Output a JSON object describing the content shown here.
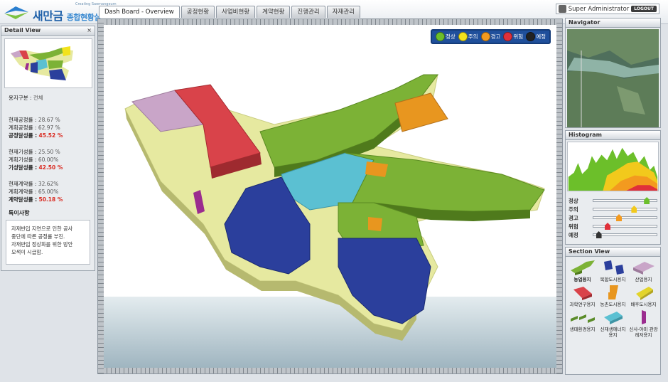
{
  "app": {
    "logo_small": "Creating Saemangeum",
    "logo_main": "새만금",
    "logo_sub": "종합현황실"
  },
  "tabs": [
    {
      "label": "Dash Board - Overview",
      "active": true
    },
    {
      "label": "공정현황",
      "active": false
    },
    {
      "label": "사업비현황",
      "active": false
    },
    {
      "label": "계약현황",
      "active": false
    },
    {
      "label": "진행관리",
      "active": false
    },
    {
      "label": "자재관리",
      "active": false
    }
  ],
  "user": {
    "name": "Super Administrator",
    "logout": "LOGOUT"
  },
  "detail": {
    "title": "Detail View",
    "close": "×",
    "land_use_label": "용지구분 :",
    "land_use_value": "전체",
    "groups": [
      [
        {
          "label": "현재공정률 :",
          "value": "28.67 %",
          "strong": false
        },
        {
          "label": "계획공정률 :",
          "value": "62.97 %",
          "strong": false
        },
        {
          "label": "공정달성률 :",
          "value": "45.52 %",
          "strong": true
        }
      ],
      [
        {
          "label": "현재기성률 :",
          "value": "25.50 %",
          "strong": false
        },
        {
          "label": "계획기성률 :",
          "value": "60.00%",
          "strong": false
        },
        {
          "label": "기성달성률 :",
          "value": "42.50 %",
          "strong": true
        }
      ],
      [
        {
          "label": "현재계약률 :",
          "value": "32.62%",
          "strong": false
        },
        {
          "label": "계획계약률 :",
          "value": "65.00%",
          "strong": false
        },
        {
          "label": "계약달성률 :",
          "value": "50.18 %",
          "strong": true
        }
      ]
    ],
    "notes_title": "특이사항",
    "notes": [
      "자재반입 지연으로 인한 공사",
      "중단에 따른 공정률 부진.",
      "자재반입 정상화를 위한 방안",
      "모색이 시급함."
    ]
  },
  "legend": [
    {
      "label": "정상",
      "color": "#6cbf2a"
    },
    {
      "label": "주의",
      "color": "#f2e21c"
    },
    {
      "label": "경고",
      "color": "#f39a1f"
    },
    {
      "label": "위험",
      "color": "#e0303a"
    },
    {
      "label": "예정",
      "color": "#222222"
    }
  ],
  "navigator": {
    "title": "Navigator"
  },
  "histogram": {
    "title": "Histogram",
    "sliders": [
      {
        "label": "정상",
        "level": 0.82,
        "color": "#6cbf2a"
      },
      {
        "label": "주의",
        "level": 0.62,
        "color": "#f2c91c"
      },
      {
        "label": "경고",
        "level": 0.38,
        "color": "#f39a1f"
      },
      {
        "label": "위험",
        "level": 0.2,
        "color": "#e0303a"
      },
      {
        "label": "예정",
        "level": 0.08,
        "color": "#333333"
      }
    ]
  },
  "section_view": {
    "title": "Section View",
    "items": [
      {
        "label": "농업용지",
        "color": "#7cb236",
        "active": true
      },
      {
        "label": "복합도시용지",
        "color": "#2b3f9c",
        "active": false
      },
      {
        "label": "산업용지",
        "color": "#c9a5c8",
        "active": false
      },
      {
        "label": "과학연구용지",
        "color": "#d9434a",
        "active": false
      },
      {
        "label": "농촌도시용지",
        "color": "#e8961f",
        "active": false
      },
      {
        "label": "배후도시용지",
        "color": "#e3d42a",
        "active": false
      },
      {
        "label": "생태환경용지",
        "color": "#5b8c2a",
        "active": false
      },
      {
        "label": "신재생에너지 용지",
        "color": "#5bc0d2",
        "active": false
      },
      {
        "label": "신사-야미 관광레저용지",
        "color": "#9b2c8f",
        "active": false
      }
    ]
  }
}
